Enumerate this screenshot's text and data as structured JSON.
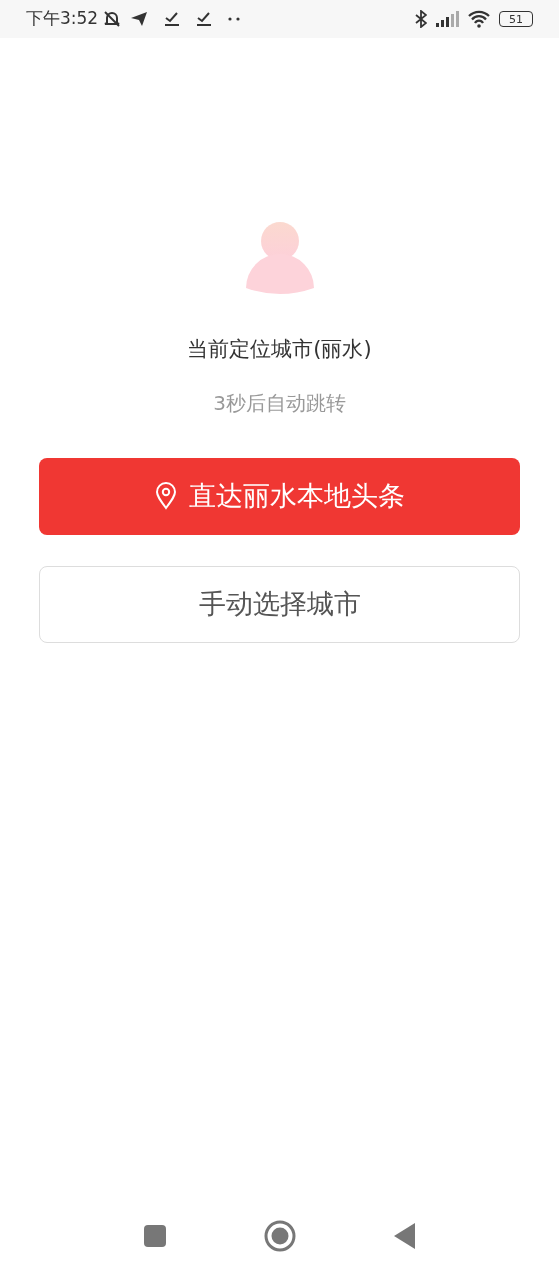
{
  "status_bar": {
    "time": "下午3:52",
    "battery": "51"
  },
  "location": {
    "title": "当前定位城市(丽水)",
    "countdown": "3秒后自动跳转"
  },
  "buttons": [
    {
      "kind": "primary",
      "label": "直达丽水本地头条"
    },
    {
      "kind": "outline",
      "label": "手动选择城市"
    }
  ]
}
